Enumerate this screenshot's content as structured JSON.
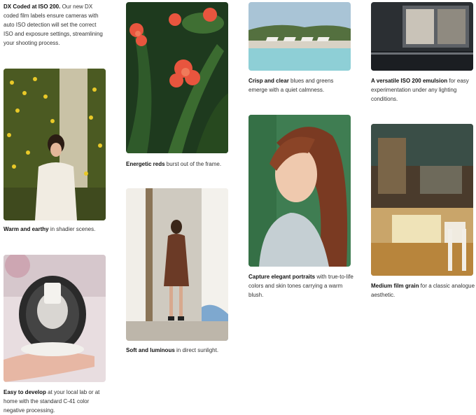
{
  "captions": {
    "dx": {
      "bold": "DX Coded at ISO 200.",
      "rest": " Our new DX coded film labels ensure cameras with auto ISO detection will set the correct ISO and exposure settings, streamlining your shooting process."
    },
    "warm": {
      "bold": "Warm and earthy",
      "rest": " in shadier scenes."
    },
    "develop": {
      "bold": "Easy to develop",
      "rest": " at your local lab or at home with the standard C-41 color negative processing."
    },
    "reds": {
      "bold": "Energetic reds",
      "rest": " burst out of the frame."
    },
    "soft": {
      "bold": "Soft and luminous",
      "rest": " in direct sunlight."
    },
    "crisp": {
      "bold": "Crisp and clear",
      "rest": " blues and greens emerge with a quiet calmness."
    },
    "portraits": {
      "bold": "Capture elegant portraits",
      "rest": " with true-to-life colors and skin tones carrying a warm blush."
    },
    "versatile": {
      "bold": "A versatile ISO 200 emulsion",
      "rest": " for easy experimentation under any lighting conditions."
    },
    "grain": {
      "bold": "Medium film grain",
      "rest": " for a classic analogue aesthetic."
    }
  },
  "photos": {
    "warm": "woman-with-yellow-flowers-photo",
    "develop": "film-roll-in-hand-photo",
    "reds": "red-flowers-photo",
    "soft": "woman-in-doorway-photo",
    "crisp": "pool-and-lounge-chairs-photo",
    "portraits": "red-haired-woman-portrait-photo",
    "versatile": "train-window-photo",
    "grain": "cafe-interior-photo"
  }
}
